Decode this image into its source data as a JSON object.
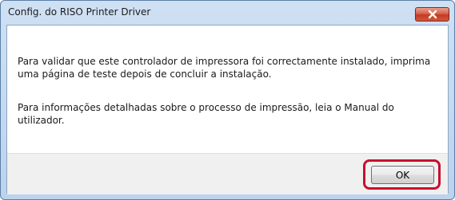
{
  "window": {
    "title": "Config. do RISO Printer Driver"
  },
  "message": {
    "paragraph1": "Para validar que este controlador de impressora foi correctamente instalado, imprima uma página de teste depois de concluir a instalação.",
    "paragraph2": "Para informações detalhadas sobre o processo de impressão, leia o Manual do utilizador."
  },
  "buttons": {
    "ok_label": "OK",
    "close_icon": "close-icon"
  },
  "colors": {
    "highlight": "#c8102e",
    "close_button": "#c23a22"
  }
}
